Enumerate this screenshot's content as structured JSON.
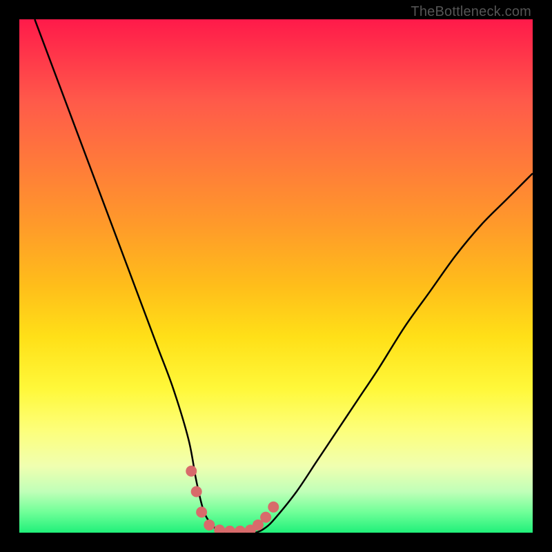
{
  "watermark": "TheBottleneck.com",
  "chart_data": {
    "type": "line",
    "title": "",
    "xlabel": "",
    "ylabel": "",
    "xlim": [
      0,
      100
    ],
    "ylim": [
      0,
      100
    ],
    "series": [
      {
        "name": "bottleneck-curve",
        "x": [
          3,
          6,
          9,
          12,
          15,
          18,
          21,
          24,
          27,
          30,
          33,
          34.5,
          36,
          38,
          40,
          42,
          44,
          46,
          48,
          50,
          54,
          58,
          62,
          66,
          70,
          75,
          80,
          85,
          90,
          95,
          100
        ],
        "y": [
          100,
          92,
          84,
          76,
          68,
          60,
          52,
          44,
          36,
          28,
          18,
          10,
          4,
          1,
          0,
          0,
          0,
          0,
          1,
          3,
          8,
          14,
          20,
          26,
          32,
          40,
          47,
          54,
          60,
          65,
          70
        ]
      }
    ],
    "highlight_dots": {
      "name": "curve-dots",
      "x": [
        33.5,
        34.5,
        35.5,
        37,
        39,
        41,
        43,
        45,
        46.5,
        48,
        49.5
      ],
      "y": [
        12,
        8,
        4,
        1.5,
        0.5,
        0.3,
        0.3,
        0.5,
        1.5,
        3,
        5
      ]
    },
    "colors": {
      "curve": "#000000",
      "dots": "#d86b6b"
    }
  }
}
